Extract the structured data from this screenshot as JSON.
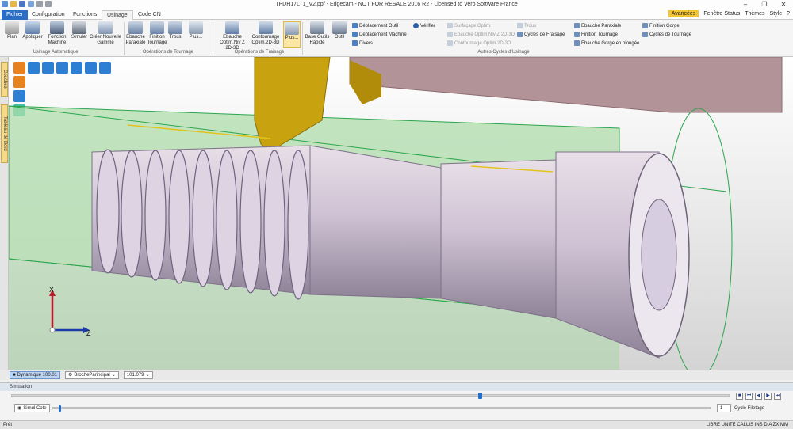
{
  "window": {
    "title": "TPDH17LT1_V2.ppf - Edgecam - NOT FOR RESALE 2016 R2 - Licensed to Vero Software France"
  },
  "tabs": [
    {
      "label": "Fichier"
    },
    {
      "label": "Configuration"
    },
    {
      "label": "Fonctions"
    },
    {
      "label": "Usinage"
    },
    {
      "label": "Code CN"
    }
  ],
  "right_menu": {
    "advanced": "Avancées",
    "status_window": "Fenêtre Status",
    "themes": "Thèmes",
    "style": "Style"
  },
  "ribbon": {
    "buttons": {
      "plan": "Plan",
      "appliquer": "Appliquer",
      "fonction_machine": "Fonction Machine",
      "simuler": "Simuler",
      "creer_gamme": "Créer Nouvelle Gamme",
      "ebauche_paraxiale": "Ebauche Paraxiale",
      "finition_tournage": "Finition Tournage",
      "trous": "Trous",
      "plus1": "Plus...",
      "ebauche_optim": "Ebauche Optim.Niv Z 2D-3D",
      "contournage_optim": "Contournage Optim.2D-3D",
      "plus2": "Plus...",
      "base_outils": "Base Outils Rapide",
      "outil": "Outil"
    },
    "groups": {
      "usinage_auto": "Usinage Automatique",
      "operations_tournage": "Opérations de Tournage",
      "operations_fraisage": "Opérations de Fraisage",
      "autres_cycles": "Autres Cycles d'Usinage"
    },
    "small_items": {
      "deplacement_outil": "Déplacement Outil",
      "deplacement_machine": "Déplacement Machine",
      "divers": "Divers",
      "verifier": "Vérifier",
      "surfacage": "Surfaçage Optim.",
      "ebauche_optim_small": "Ebauche Optim.Niv Z 2D-3D",
      "contournage_small": "Contournage Optim.2D-3D",
      "trous_small": "Trous",
      "cycles_fraisage": "Cycles de Fraisage",
      "ebauche_paraxiale_small": "Ebauche Paraxiale",
      "finition_tournage_small": "Finition Tournage",
      "ebauche_gorge": "Ebauche Gorge en plongée",
      "finition_gorge": "Finition Gorge",
      "cycles_tournage": "Cycles de Tournage"
    }
  },
  "side_tabs": {
    "couches": "Couches",
    "tableau_bord": "Tableau de Bord"
  },
  "axes": {
    "x": "X",
    "z": "Z"
  },
  "status_row": {
    "mode": "Dynamique 100.01",
    "broche": "BrocheParincipal",
    "value": "101.079"
  },
  "simulation": {
    "header": "Simulation",
    "simul_cote": "Simul Cote",
    "cycle_number": "1",
    "cycle_label": "Cycle Filetage",
    "progress_main": 0.65,
    "progress_sub": 0.01
  },
  "bottom": {
    "left": "Prêt",
    "right": "LIBRE UNITE CALLIS INS DIA ZX MM"
  }
}
